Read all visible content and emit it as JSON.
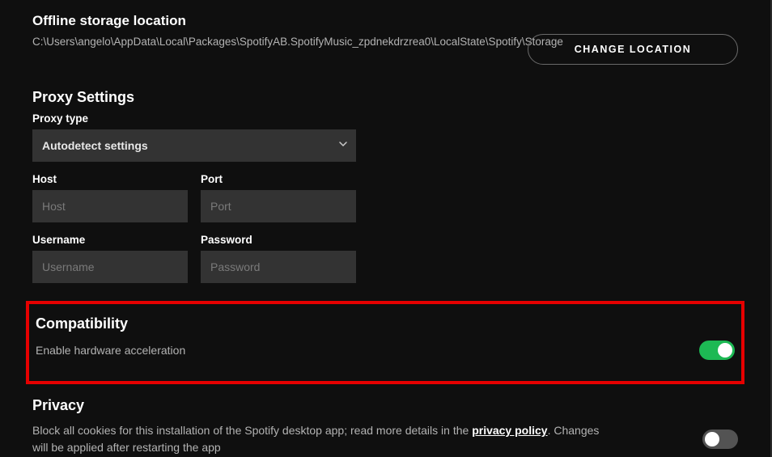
{
  "offline": {
    "title": "Offline storage location",
    "path": "C:\\Users\\angelo\\AppData\\Local\\Packages\\SpotifyAB.SpotifyMusic_zpdnekdrzrea0\\LocalState\\Spotify\\Storage",
    "change_btn": "CHANGE LOCATION"
  },
  "proxy": {
    "title": "Proxy Settings",
    "type_label": "Proxy type",
    "type_value": "Autodetect settings",
    "host_label": "Host",
    "host_placeholder": "Host",
    "host_value": "",
    "port_label": "Port",
    "port_placeholder": "Port",
    "port_value": "",
    "user_label": "Username",
    "user_placeholder": "Username",
    "user_value": "",
    "pass_label": "Password",
    "pass_placeholder": "Password",
    "pass_value": ""
  },
  "compat": {
    "title": "Compatibility",
    "hw_accel_label": "Enable hardware acceleration",
    "hw_accel_on": true
  },
  "privacy": {
    "title": "Privacy",
    "cookies_prefix": "Block all cookies for this installation of the Spotify desktop app; read more details in the ",
    "cookies_link": "privacy policy",
    "cookies_suffix": ". Changes will be applied after restarting the app",
    "cookies_on": false
  }
}
